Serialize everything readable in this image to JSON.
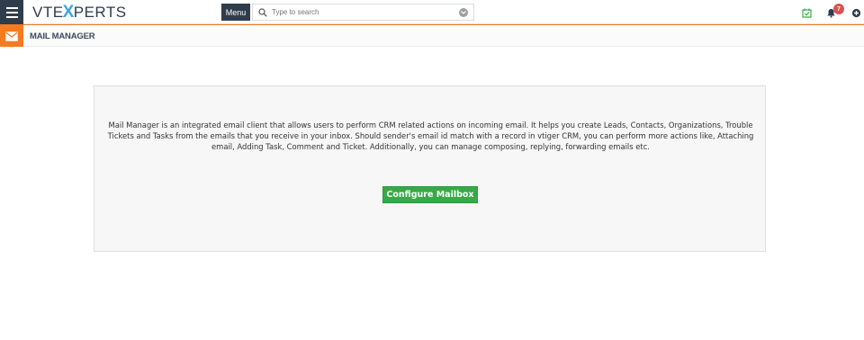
{
  "header": {
    "logo_prefix": "VTE",
    "logo_x": "X",
    "logo_suffix": "PERTS",
    "menu_label": "Menu",
    "search_placeholder": "Type to search",
    "notification_count": "7",
    "icons": {
      "hamburger": "hamburger-menu-icon",
      "search": "search-icon",
      "dropdown": "chevron-down-icon",
      "calendar": "calendar-check-icon",
      "bell": "bell-icon",
      "add": "plus-circle-icon"
    }
  },
  "module": {
    "title": "MAIL MANAGER",
    "icon": "envelope-icon"
  },
  "main": {
    "description": "Mail Manager is an integrated email client that allows users to perform CRM related actions on incoming email. It helps you create Leads, Contacts, Organizations, Trouble Tickets and Tasks from the emails that you receive in your inbox. Should sender's email id match with a record in vtiger CRM, you can perform more actions like, Attaching email, Adding Task, Comment and Ticket. Additionally, you can manage composing, replying, forwarding emails etc.",
    "configure_button": "Configure Mailbox"
  },
  "colors": {
    "dark_navy": "#2f3c4b",
    "accent_orange": "#f47b20",
    "logo_blue": "#3da5de",
    "button_green": "#35aa47",
    "badge_red": "#d9534f"
  }
}
